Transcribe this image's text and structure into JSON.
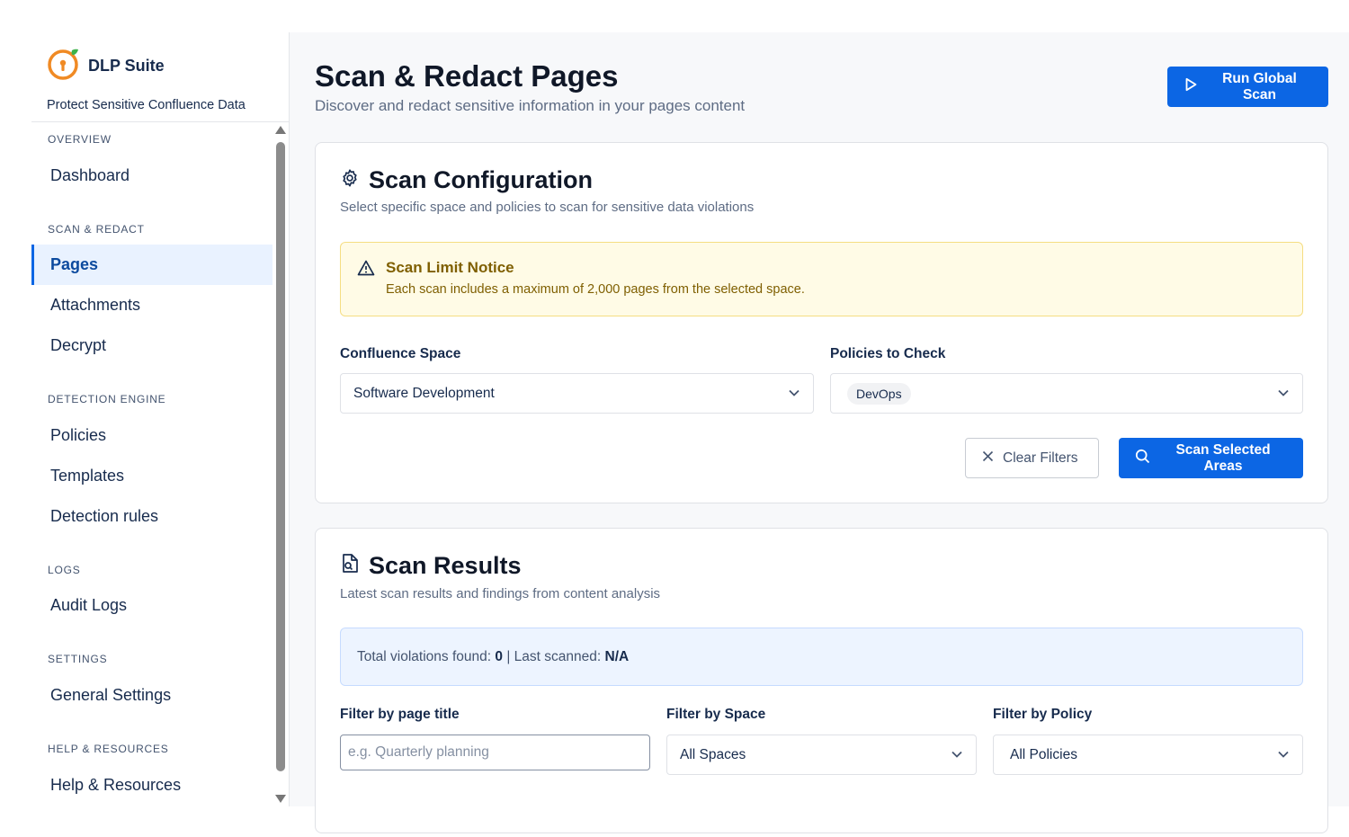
{
  "colors": {
    "accent": "#0c66e4",
    "warning_bg": "#fffbe6",
    "info_bg": "#edf4ff"
  },
  "brand": {
    "name": "DLP Suite",
    "tagline": "Protect Sensitive Confluence Data",
    "logo_icon": "keyhole-logo-icon"
  },
  "sidebar": {
    "sections": [
      {
        "label": "OVERVIEW"
      },
      {
        "label": "SCAN & REDACT"
      },
      {
        "label": "DETECTION ENGINE"
      },
      {
        "label": "LOGS"
      },
      {
        "label": "SETTINGS"
      },
      {
        "label": "HELP & RESOURCES"
      }
    ],
    "items": [
      {
        "label": "Dashboard"
      },
      {
        "label": "Pages",
        "active": true
      },
      {
        "label": "Attachments"
      },
      {
        "label": "Decrypt"
      },
      {
        "label": "Policies"
      },
      {
        "label": "Templates"
      },
      {
        "label": "Detection rules"
      },
      {
        "label": "Audit Logs"
      },
      {
        "label": "General Settings"
      },
      {
        "label": "Help & Resources"
      }
    ]
  },
  "header": {
    "title": "Scan & Redact Pages",
    "subtitle": "Discover and redact sensitive information in your pages content",
    "run_button": "Run Global Scan"
  },
  "config": {
    "title": "Scan Configuration",
    "subtitle": "Select specific space and policies to scan for sensitive data violations",
    "notice_title": "Scan Limit Notice",
    "notice_text": "Each scan includes a maximum of 2,000 pages from the selected space.",
    "space_label": "Confluence Space",
    "space_value": "Software Development",
    "policies_label": "Policies to Check",
    "policies_selected": [
      "DevOps"
    ],
    "clear_button": "Clear Filters",
    "scan_button": "Scan Selected Areas"
  },
  "results": {
    "title": "Scan Results",
    "subtitle": "Latest scan results and findings from content analysis",
    "violations_label": "Total violations found:",
    "violations_count": "0",
    "separator": "|",
    "last_scanned_label": "Last scanned:",
    "last_scanned_value": "N/A",
    "filter_title_label": "Filter by page title",
    "filter_title_placeholder": "e.g. Quarterly planning",
    "filter_space_label": "Filter by Space",
    "filter_space_value": "All Spaces",
    "filter_policy_label": "Filter by Policy",
    "filter_policy_value": "All Policies"
  }
}
